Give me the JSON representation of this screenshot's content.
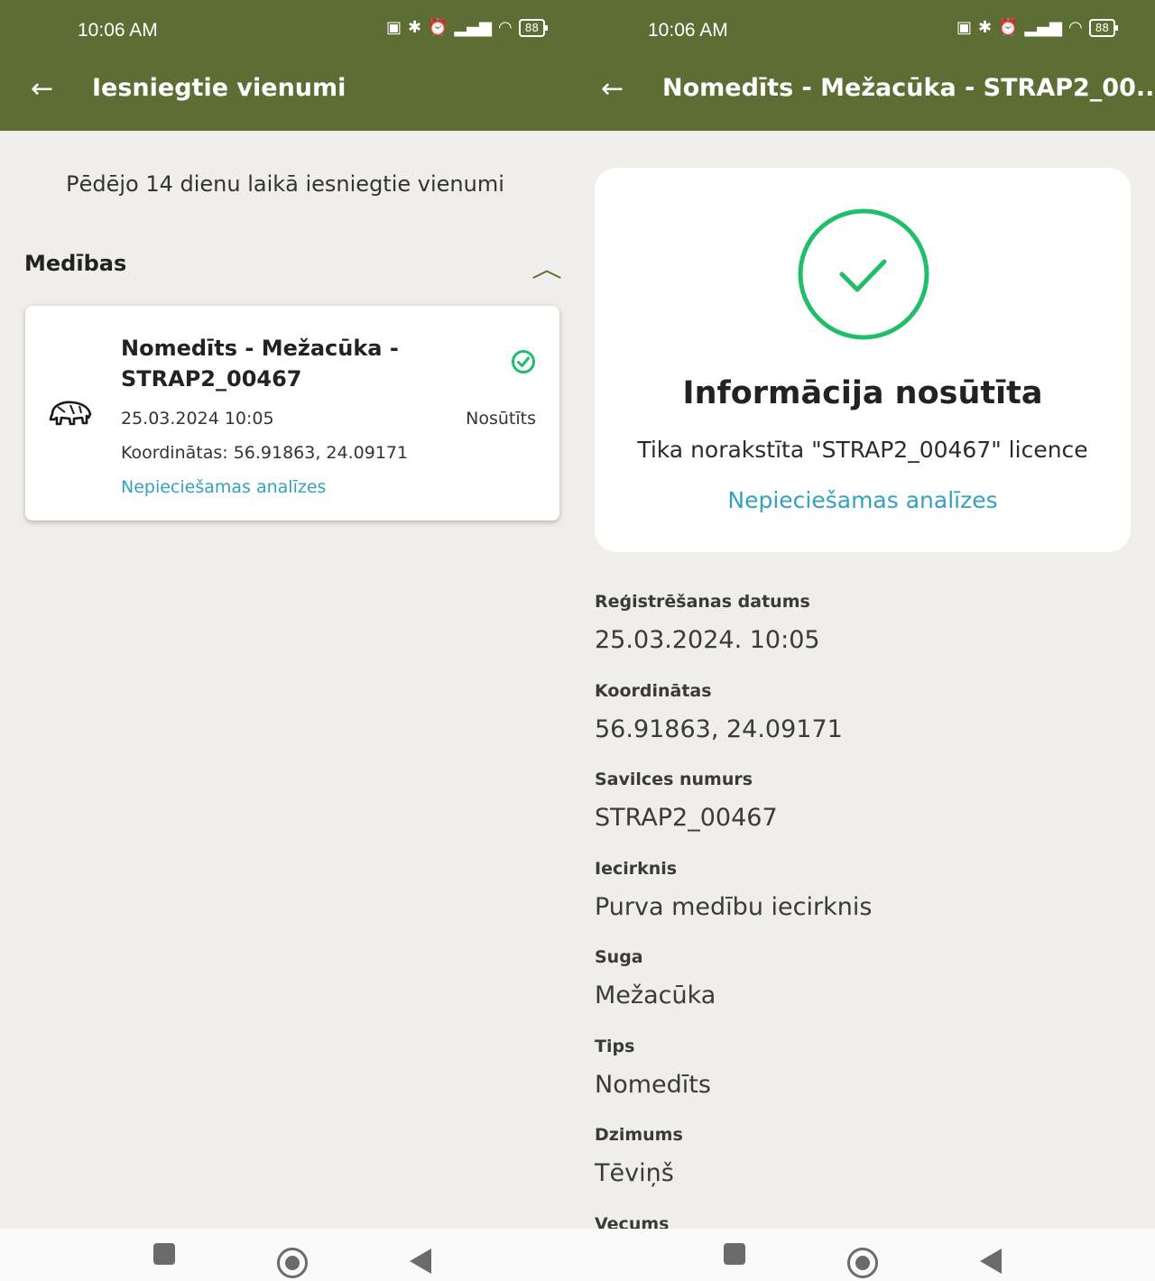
{
  "status": {
    "time": "10:06 AM",
    "battery": "88"
  },
  "left": {
    "title": "Iesniegtie vienumi",
    "subtitle": "Pēdējo 14 dienu laikā iesniegtie vienumi",
    "section": "Medības",
    "card": {
      "title": "Nomedīts - Mežacūka - STRAP2_00467",
      "date": "25.03.2024 10:05",
      "status": "Nosūtīts",
      "coords": "Koordinātas: 56.91863, 24.09171",
      "link": "Nepieciešamas analīzes"
    }
  },
  "right": {
    "title": "Nomedīts - Mežacūka - STRAP2_00..",
    "confirm_title": "Informācija nosūtīta",
    "confirm_text": "Tika norakstīta \"STRAP2_00467\" licence",
    "confirm_link": "Nepieciešamas analīzes",
    "fields": [
      {
        "label": "Reģistrēšanas datums",
        "value": "25.03.2024. 10:05"
      },
      {
        "label": "Koordinātas",
        "value": "56.91863, 24.09171"
      },
      {
        "label": "Savilces numurs",
        "value": "STRAP2_00467"
      },
      {
        "label": "Iecirknis",
        "value": "Purva medību iecirknis"
      },
      {
        "label": "Suga",
        "value": "Mežacūka"
      },
      {
        "label": "Tips",
        "value": "Nomedīts"
      },
      {
        "label": "Dzimums",
        "value": "Tēviņš"
      },
      {
        "label": "Vecums",
        "value": ""
      }
    ]
  },
  "colors": {
    "appbar": "#5d6e35",
    "success": "#1fbe69",
    "link": "#32a1c4",
    "background": "#efeeea"
  }
}
